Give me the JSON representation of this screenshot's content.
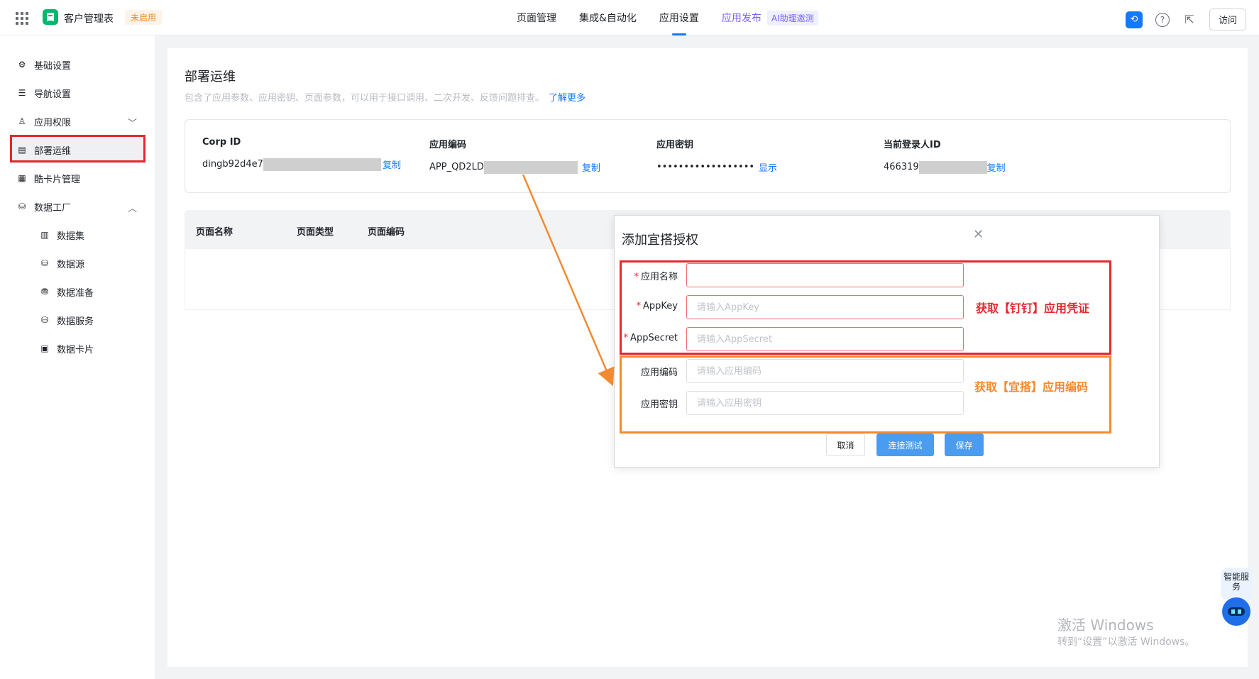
{
  "topbar": {
    "app_title": "客户管理表",
    "status_badge": "未启用",
    "tabs": [
      "页面管理",
      "集成&自动化",
      "应用设置",
      "应用发布"
    ],
    "active_tab": "应用设置",
    "ai_badge": "AI助理邀测",
    "visit_label": "访问"
  },
  "sidebar": {
    "items": [
      "基础设置",
      "导航设置",
      "应用权限",
      "部署运维",
      "酷卡片管理",
      "数据工厂"
    ],
    "sub_items": [
      "数据集",
      "数据源",
      "数据准备",
      "数据服务",
      "数据卡片"
    ],
    "active_item": "部署运维"
  },
  "main": {
    "title": "部署运维",
    "description": "包含了应用参数、应用密钥、页面参数，可以用于接口调用、二次开发、反馈问题排查。",
    "learn_more": "了解更多",
    "credentials": [
      {
        "label": "Corp ID",
        "value": "dingb92d4e7",
        "action": "复制"
      },
      {
        "label": "应用编码",
        "value": "APP_QD2LD",
        "action": "复制"
      },
      {
        "label": "应用密钥",
        "value": "••••••••••••••••••",
        "action": "显示"
      },
      {
        "label": "当前登录人ID",
        "value": "466319",
        "action": "复制"
      }
    ],
    "table_headers": [
      "页面名称",
      "页面类型",
      "页面编码"
    ]
  },
  "modal": {
    "title": "添加宜搭授权",
    "fields": [
      {
        "label": "应用名称",
        "required": true,
        "placeholder": "",
        "value": ""
      },
      {
        "label": "AppKey",
        "required": true,
        "placeholder": "请输入AppKey",
        "value": ""
      },
      {
        "label": "AppSecret",
        "required": true,
        "placeholder": "请输入AppSecret",
        "value": ""
      },
      {
        "label": "应用编码",
        "required": false,
        "placeholder": "请输入应用编码",
        "value": ""
      },
      {
        "label": "应用密钥",
        "required": false,
        "placeholder": "请输入应用密钥",
        "value": ""
      }
    ],
    "buttons": {
      "cancel": "取消",
      "test": "连接测试",
      "save": "保存"
    }
  },
  "annotations": {
    "red": "获取【钉钉】应用凭证",
    "orange": "获取【宜搭】应用编码"
  },
  "float_service": {
    "label": "智能服务"
  },
  "watermark": {
    "line1": "激活 Windows",
    "line2": "转到“设置”以激活 Windows。"
  },
  "colors": {
    "accent": "#1677ff",
    "annotation_red": "#e8262d",
    "annotation_orange": "#f38a2f",
    "status_orange": "#f08a24"
  }
}
